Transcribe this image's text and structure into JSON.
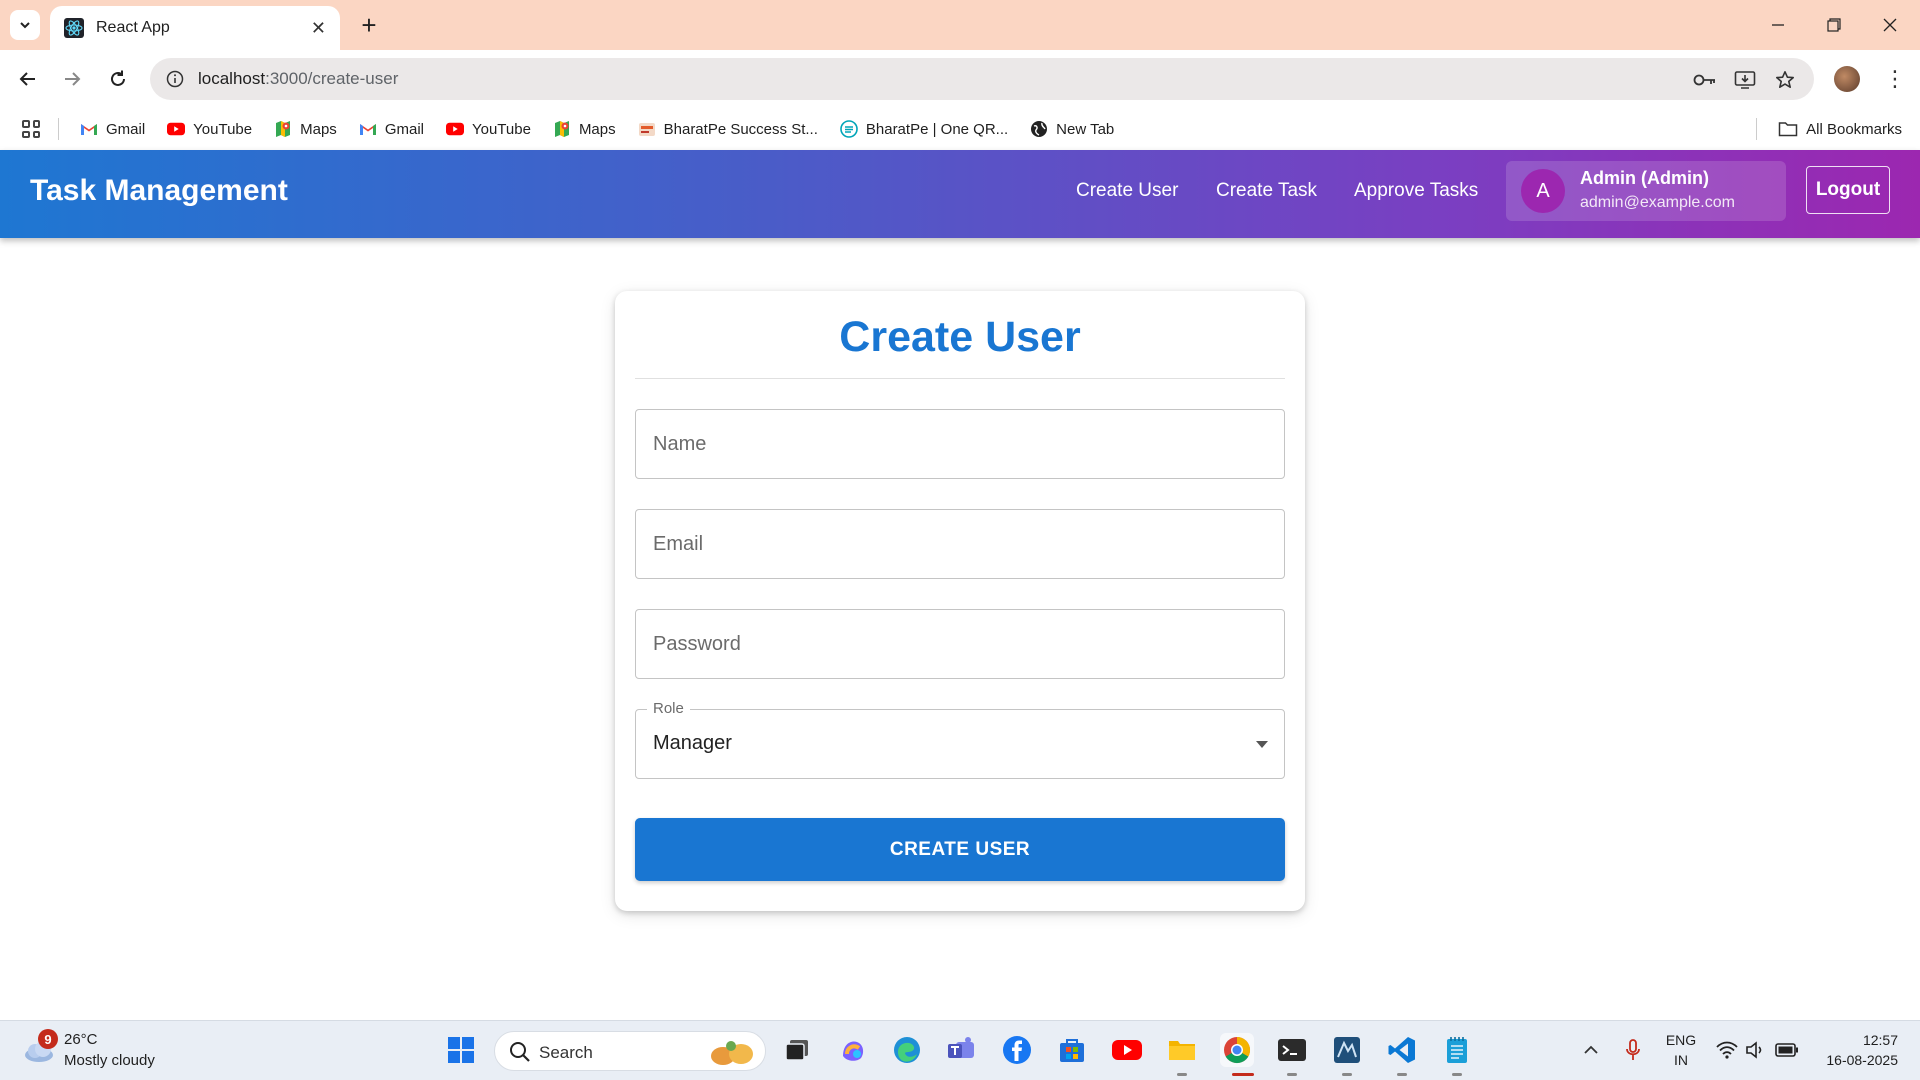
{
  "browser": {
    "tab_title": "React App",
    "url_host": "localhost",
    "url_path": ":3000/create-user",
    "bookmarks": [
      {
        "label": "Gmail",
        "icon": "gmail-icon"
      },
      {
        "label": "YouTube",
        "icon": "youtube-icon"
      },
      {
        "label": "Maps",
        "icon": "maps-icon"
      },
      {
        "label": "Gmail",
        "icon": "gmail-icon"
      },
      {
        "label": "YouTube",
        "icon": "youtube-icon"
      },
      {
        "label": "Maps",
        "icon": "maps-icon"
      },
      {
        "label": "BharatPe Success St...",
        "icon": "bharatpe-icon"
      },
      {
        "label": "BharatPe | One QR...",
        "icon": "bharatpe-qr-icon"
      },
      {
        "label": "New Tab",
        "icon": "globe-icon"
      }
    ],
    "all_bookmarks_label": "All Bookmarks"
  },
  "app": {
    "title": "Task Management",
    "nav": [
      "Create User",
      "Create Task",
      "Approve Tasks"
    ],
    "user": {
      "initial": "A",
      "name": "Admin (Admin)",
      "email": "admin@example.com"
    },
    "logout_label": "Logout",
    "colors": {
      "primary": "#1976d2",
      "accent": "#9c27b0"
    }
  },
  "form": {
    "title": "Create User",
    "name_placeholder": "Name",
    "email_placeholder": "Email",
    "password_placeholder": "Password",
    "role_label": "Role",
    "role_value": "Manager",
    "submit_label": "CREATE USER"
  },
  "taskbar": {
    "weather_badge": "9",
    "temperature": "26°C",
    "condition": "Mostly cloudy",
    "search_label": "Search",
    "language": "ENG",
    "region": "IN",
    "time": "12:57",
    "date": "16-08-2025"
  }
}
